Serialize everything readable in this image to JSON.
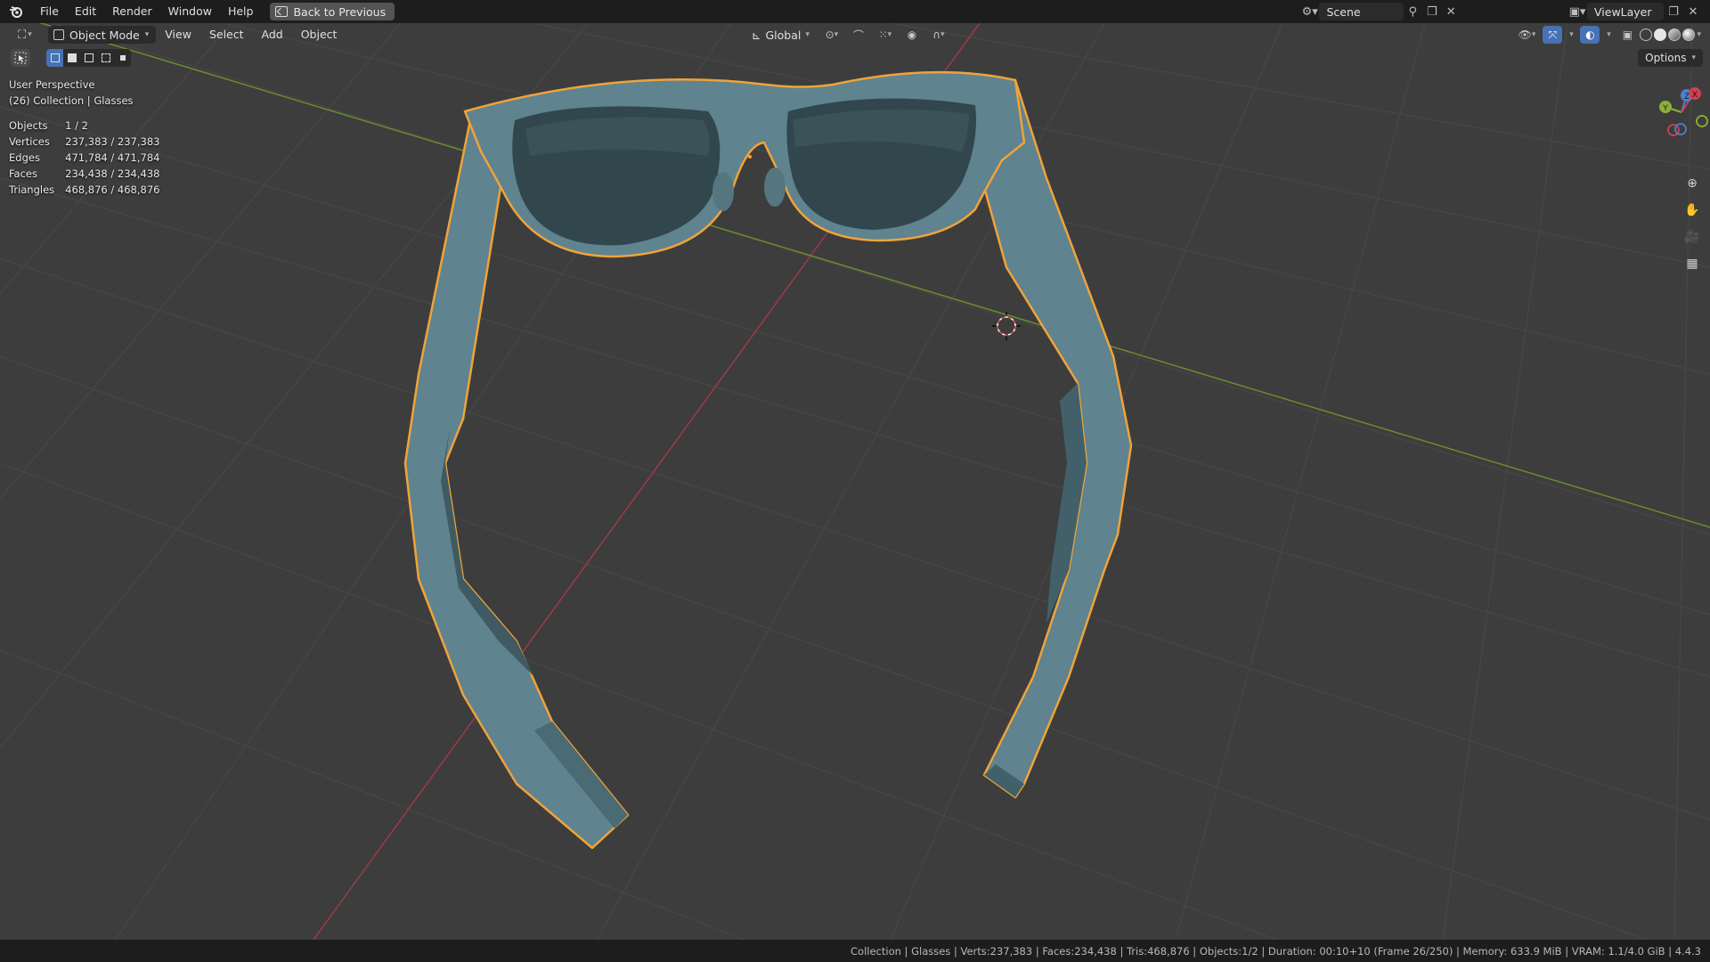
{
  "menu": {
    "file": "File",
    "edit": "Edit",
    "render": "Render",
    "window": "Window",
    "help": "Help",
    "back_to_previous": "Back to Previous"
  },
  "scene": {
    "name": "Scene"
  },
  "view_layer": {
    "name": "ViewLayer"
  },
  "viewport_header": {
    "mode": "Object Mode",
    "view": "View",
    "select": "Select",
    "add": "Add",
    "object": "Object",
    "orientation": "Global",
    "options": "Options"
  },
  "overlay": {
    "perspective": "User Perspective",
    "collection": "(26) Collection | Glasses",
    "stats": [
      {
        "label": "Objects",
        "value": "1 / 2"
      },
      {
        "label": "Vertices",
        "value": "237,383 / 237,383"
      },
      {
        "label": "Edges",
        "value": "471,784 / 471,784"
      },
      {
        "label": "Faces",
        "value": "234,438 / 234,438"
      },
      {
        "label": "Triangles",
        "value": "468,876 / 468,876"
      }
    ]
  },
  "gizmo": {
    "x": "X",
    "y": "Y",
    "z": "Z"
  },
  "status_bar": {
    "text": "Collection | Glasses | Verts:237,383 | Faces:234,438 | Tris:468,876 | Objects:1/2 | Duration: 00:10+10 (Frame 26/250) | Memory: 633.9 MiB | VRAM: 1.1/4.0 GiB | 4.4.3"
  },
  "colors": {
    "viewport_bg": "#3d3d3d",
    "grid": "#474747",
    "x_axis": "#9c3a47",
    "y_axis": "#6b8d2c",
    "selection_outline": "#f0a33a",
    "object_color": "#5f838f",
    "accent": "#4772b3"
  },
  "icons": {
    "blender": "blender-logo-icon",
    "back": "back-icon",
    "scene": "scene-icon",
    "pin": "pin-icon",
    "new": "new-icon",
    "close": "close-icon",
    "viewlayer": "viewlayer-icon",
    "editor_type": "3d-viewport-icon",
    "orientation": "transform-orientation-icon",
    "pivot": "pivot-icon",
    "snap": "snap-icon",
    "proportional": "proportional-edit-icon",
    "visibility": "visibility-icon",
    "gizmos": "gizmo-icon",
    "overlays": "overlay-icon",
    "xray": "xray-icon",
    "zoom": "zoom-icon",
    "pan": "hand-icon",
    "camera": "camera-icon",
    "ortho": "grid-icon"
  }
}
